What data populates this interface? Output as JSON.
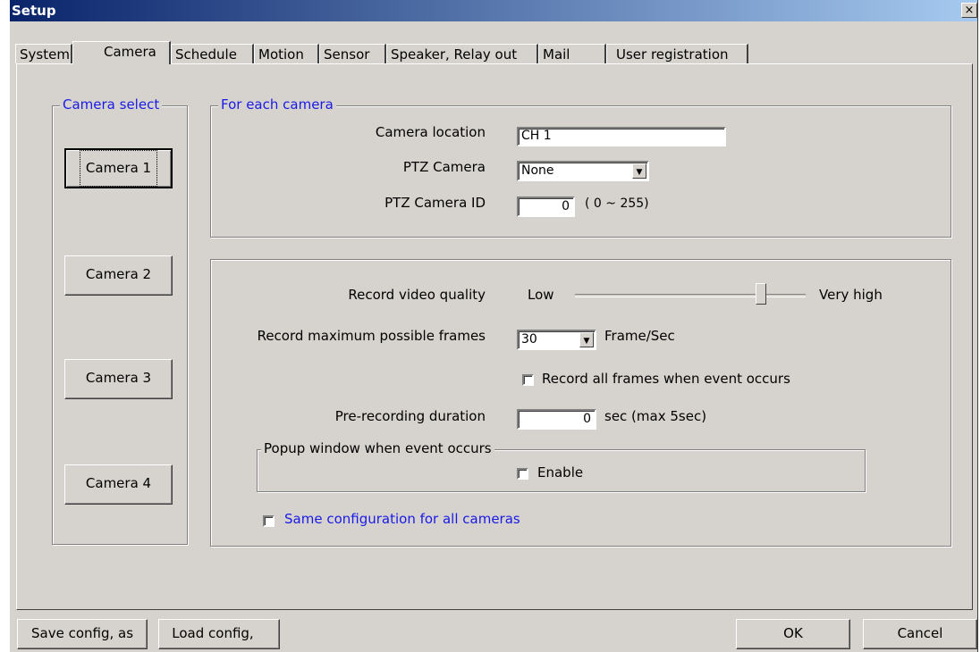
{
  "window": {
    "title": "Setup",
    "close_glyph": "×"
  },
  "tabs": [
    "System",
    "Camera",
    "Schedule",
    "Motion",
    "Sensor",
    "Speaker, Relay out",
    "Mail",
    "User registration"
  ],
  "camera_select": {
    "legend": "Camera select",
    "buttons": [
      "Camera 1",
      "Camera 2",
      "Camera 3",
      "Camera 4"
    ]
  },
  "each_camera": {
    "legend": "For each camera",
    "location_label": "Camera location",
    "location_value": "CH 1",
    "ptz_label": "PTZ Camera",
    "ptz_value": "None",
    "ptz_id_label": "PTZ Camera ID",
    "ptz_id_value": "0",
    "ptz_id_range": "( 0 ~ 255)"
  },
  "recording": {
    "quality_label": "Record video quality",
    "quality_low": "Low",
    "quality_high": "Very high",
    "quality_level": 0.82,
    "frames_label": "Record maximum possible frames",
    "frames_value": "30",
    "frames_unit": "Frame/Sec",
    "all_frames_label": "Record all frames when event occurs",
    "all_frames_checked": false,
    "prerec_label": "Pre-recording duration",
    "prerec_value": "0",
    "prerec_unit": "sec (max 5sec)",
    "popup_legend": "Popup window when event occurs",
    "popup_enable_label": "Enable",
    "popup_enable_checked": false,
    "same_config_label": "Same configuration for all cameras",
    "same_config_checked": false
  },
  "footer": {
    "save_label": "Save config, as",
    "load_label": "Load config,",
    "ok_label": "OK",
    "cancel_label": "Cancel"
  },
  "colors": {
    "face": "#d6d3ce",
    "title_start": "#0a246a",
    "title_end": "#a6caf0",
    "legend_blue": "#1a1ae6"
  }
}
